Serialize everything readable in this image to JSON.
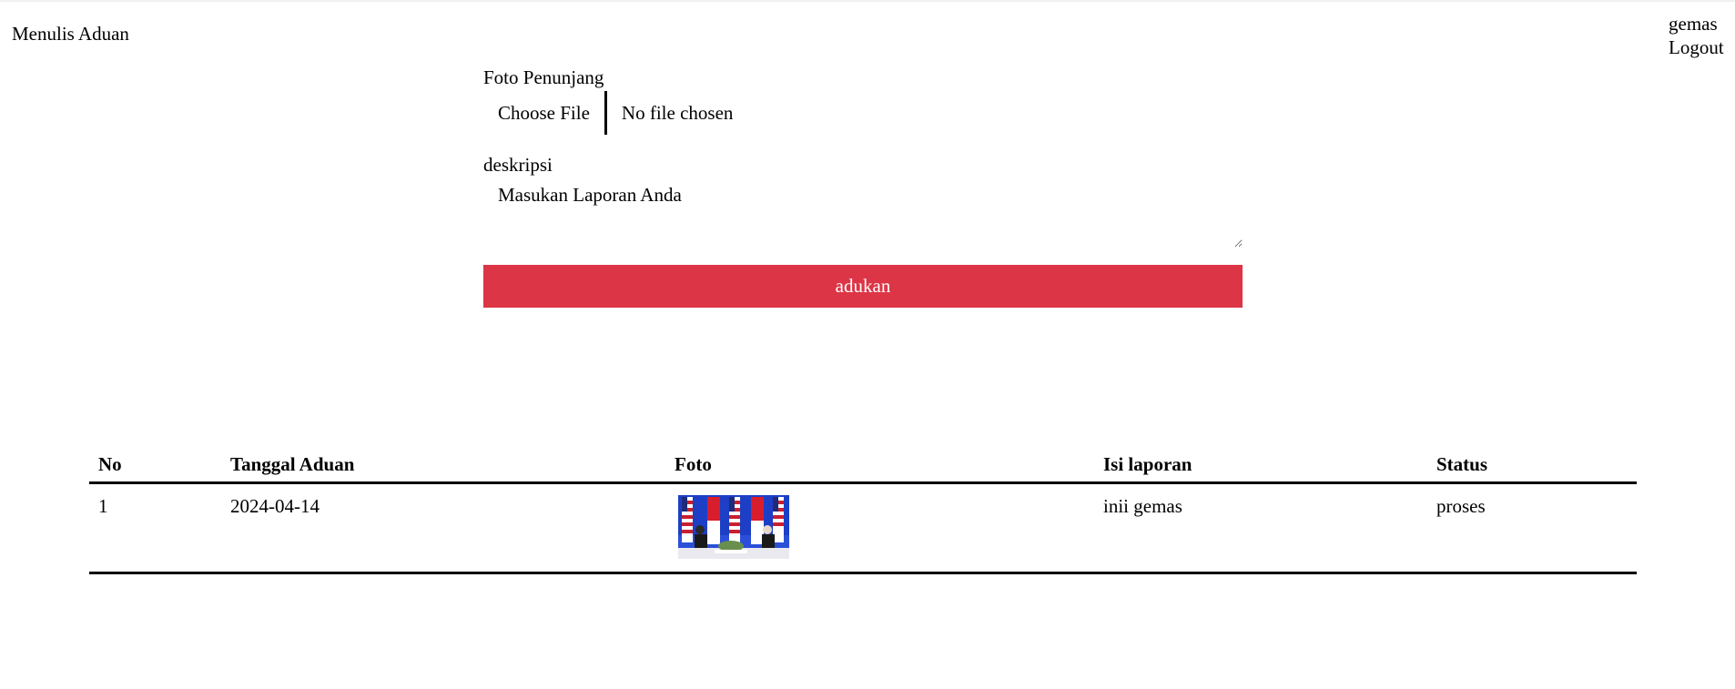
{
  "header": {
    "title": "Menulis Aduan",
    "username": "gemas",
    "logout_label": "Logout"
  },
  "form": {
    "photo_label": "Foto Penunjang",
    "choose_file_label": "Choose File",
    "no_file_text": "No file chosen",
    "description_label": "deskripsi",
    "description_placeholder": "Masukan Laporan Anda",
    "description_value": "",
    "submit_label": "adukan"
  },
  "colors": {
    "submit_background": "#dc3545",
    "submit_text": "#ffffff"
  },
  "table": {
    "headers": [
      "No",
      "Tanggal Aduan",
      "Foto",
      "Isi laporan",
      "Status"
    ],
    "rows": [
      {
        "no": "1",
        "date": "2024-04-14",
        "photo_icon": "photo-thumbnail",
        "content": "inii gemas",
        "status": "proses"
      }
    ]
  }
}
